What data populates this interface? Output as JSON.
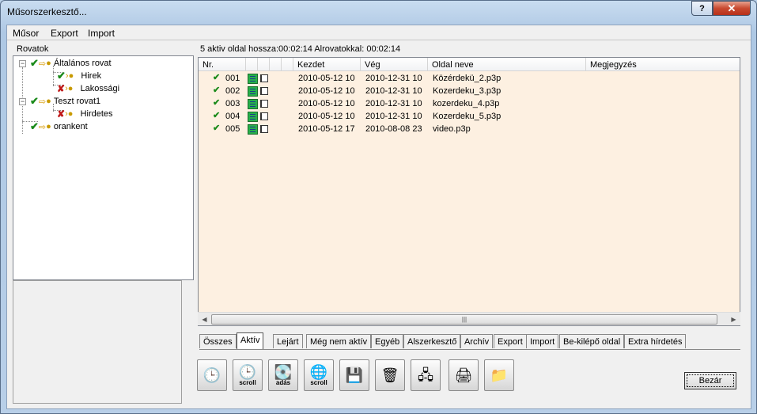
{
  "window": {
    "title": "Műsorszerkesztő...",
    "help_label": "?",
    "close_label": "✕"
  },
  "menu": [
    "Műsor",
    "Export",
    "Import"
  ],
  "tree": {
    "label": "Rovatok",
    "nodes": [
      {
        "label": "Általános rovat",
        "status": "check"
      },
      {
        "label": "Hirek",
        "status": "check"
      },
      {
        "label": "Lakossági",
        "status": "cross"
      },
      {
        "label": "Teszt rovat1",
        "status": "check"
      },
      {
        "label": "Hirdetes",
        "status": "cross"
      },
      {
        "label": "orankent",
        "status": "check"
      }
    ]
  },
  "summary": "5 aktiv oldal hossza:00:02:14  Alrovatokkal: 00:02:14",
  "list": {
    "headers": [
      "Nr.",
      "",
      "",
      "",
      "Kezdet",
      "Vég",
      "Oldal neve",
      "Megjegyzés"
    ],
    "rows": [
      {
        "nr": "001",
        "kezdet": "2010-05-12  10",
        "veg": "2010-12-31  10",
        "nev": "Közérdekü_2.p3p",
        "megjegyzes": ""
      },
      {
        "nr": "002",
        "kezdet": "2010-05-12  10",
        "veg": "2010-12-31  10",
        "nev": "Kozerdeku_3.p3p",
        "megjegyzes": ""
      },
      {
        "nr": "003",
        "kezdet": "2010-05-12  10",
        "veg": "2010-12-31  10",
        "nev": "kozerdeku_4.p3p",
        "megjegyzes": ""
      },
      {
        "nr": "004",
        "kezdet": "2010-05-12  10",
        "veg": "2010-12-31  10",
        "nev": "Kozerdeku_5.p3p",
        "megjegyzes": ""
      },
      {
        "nr": "005",
        "kezdet": "2010-05-12  17",
        "veg": "2010-08-08  23",
        "nev": "video.p3p",
        "megjegyzes": ""
      }
    ]
  },
  "tabs": [
    "Összes",
    "Aktív",
    "Lejárt",
    "Még nem aktív",
    "Egyéb",
    "Alszerkesztő",
    "Archív",
    "Export",
    "Import",
    "Be-kilépő oldal",
    "Extra hírdetés"
  ],
  "active_tab": "Aktív",
  "toolbar": [
    {
      "name": "clock-video-button",
      "glyph": "🕒",
      "sub": ""
    },
    {
      "name": "clock-scroll-button",
      "glyph": "🕒",
      "sub": "scroll"
    },
    {
      "name": "broadcast-disk-button",
      "glyph": "💽",
      "sub": "adás"
    },
    {
      "name": "scroll-globe-button",
      "glyph": "🌐",
      "sub": "scroll"
    },
    {
      "name": "save-button",
      "glyph": "💾",
      "sub": ""
    },
    {
      "name": "delete-button",
      "glyph": "🗑",
      "sub": ""
    },
    {
      "name": "network-button",
      "glyph": "🖧",
      "sub": ""
    },
    {
      "name": "print-button",
      "glyph": "🖨",
      "sub": ""
    },
    {
      "name": "folder-button",
      "glyph": "📁",
      "sub": ""
    }
  ],
  "close_button": "Bezár"
}
